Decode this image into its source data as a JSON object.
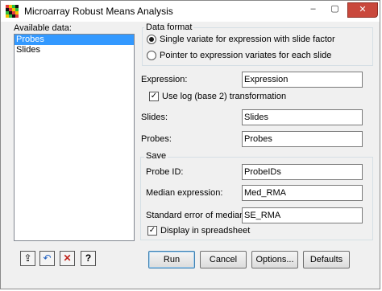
{
  "window": {
    "title": "Microarray Robust Means Analysis",
    "controls": {
      "minimize": "–",
      "maximize": "▢",
      "close": "✕"
    }
  },
  "available_data": {
    "label": "Available data:",
    "items": [
      "Probes",
      "Slides"
    ],
    "selected": "Probes"
  },
  "data_format": {
    "title": "Data format",
    "options": [
      {
        "label": "Single variate for expression with slide factor",
        "checked": true
      },
      {
        "label": "Pointer to expression variates for each slide",
        "checked": false
      }
    ]
  },
  "fields": {
    "expression": {
      "label": "Expression:",
      "value": "Expression"
    },
    "log_transform": {
      "label": "Use log (base 2) transformation",
      "checked": true
    },
    "slides": {
      "label": "Slides:",
      "value": "Slides"
    },
    "probes": {
      "label": "Probes:",
      "value": "Probes"
    }
  },
  "save": {
    "title": "Save",
    "probe_id": {
      "label": "Probe ID:",
      "value": "ProbeIDs"
    },
    "median_expression": {
      "label": "Median expression:",
      "value": "Med_RMA"
    },
    "std_error": {
      "label": "Standard error of median:",
      "value": "SE_RMA"
    },
    "display_spreadsheet": {
      "label": "Display in spreadsheet",
      "checked": true
    }
  },
  "buttons": {
    "run": "Run",
    "cancel": "Cancel",
    "options": "Options...",
    "defaults": "Defaults"
  },
  "toolbar_icons": {
    "pin": "⇪",
    "undo": "↶",
    "clear": "✕",
    "help": "?"
  },
  "colors": {
    "selection": "#3399ff",
    "close_button": "#c9483c",
    "default_button_border": "#3c7fb1"
  }
}
